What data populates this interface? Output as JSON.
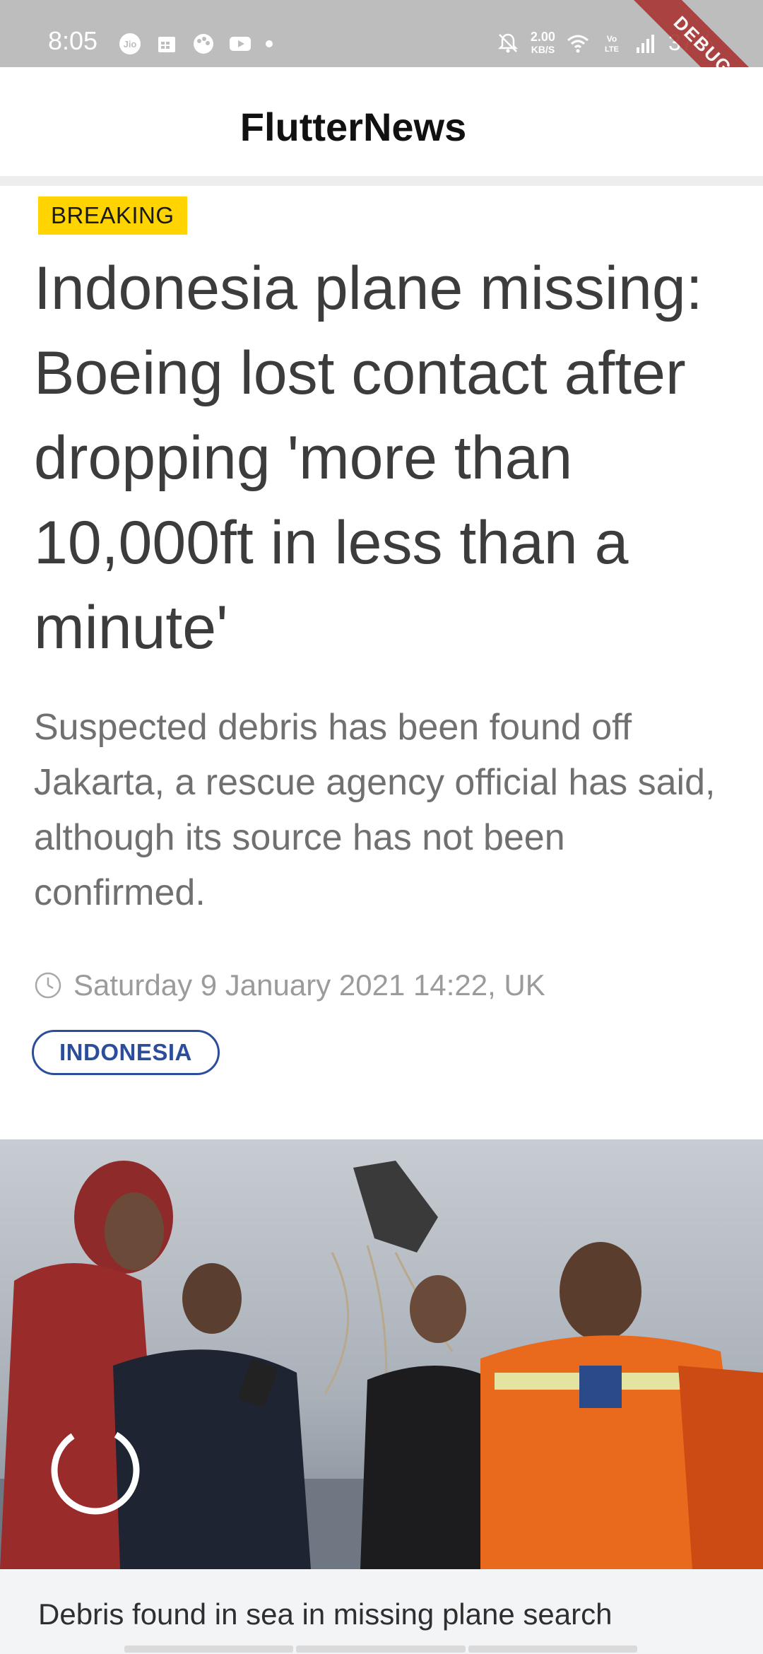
{
  "status_bar": {
    "time": "8:05",
    "left_icons": [
      "jio-icon",
      "calendar-icon",
      "palette-icon",
      "youtube-icon",
      "dot-icon"
    ],
    "net_speed": "2.00",
    "net_unit": "KB/S",
    "right_icons": [
      "bell-off-icon",
      "wifi-icon",
      "volte-icon",
      "signal-icon"
    ],
    "battery": "37%"
  },
  "debug_banner": "DEBUG",
  "app_bar": {
    "title": "FlutterNews"
  },
  "article": {
    "badge": "BREAKING",
    "headline": "Indonesia plane missing: Boeing lost contact after dropping 'more than 10,000ft in less than a minute'",
    "summary": "Suspected debris has been found off Jakarta, a rescue agency official has said, although its source has not been confirmed.",
    "timestamp": "Saturday 9 January 2021 14:22, UK",
    "tag": "INDONESIA",
    "video_caption": "Debris found in sea in missing plane search"
  },
  "colors": {
    "badge_bg": "#ffd400",
    "tag_border": "#2b4d9c",
    "status_bar_bg": "#bdbdbd",
    "debug_bg": "#a83535"
  }
}
